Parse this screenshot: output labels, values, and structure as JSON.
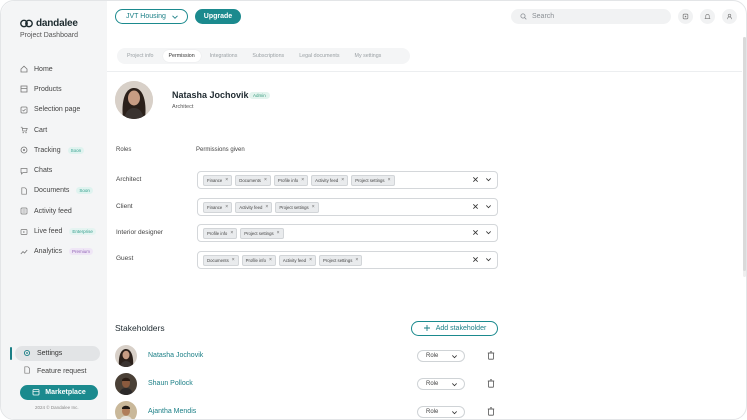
{
  "app": {
    "logo_text": "dandalee",
    "subtitle": "Project Dashboard",
    "copyright": "2024 © Dandalee Inc."
  },
  "sidebar": {
    "items": [
      {
        "label": "Home",
        "icon": "home-icon"
      },
      {
        "label": "Products",
        "icon": "products-icon"
      },
      {
        "label": "Selection page",
        "icon": "selection-icon"
      },
      {
        "label": "Cart",
        "icon": "cart-icon"
      },
      {
        "label": "Tracking",
        "icon": "tracking-icon",
        "tag": "Soon"
      },
      {
        "label": "Chats",
        "icon": "chat-icon"
      },
      {
        "label": "Documents",
        "icon": "documents-icon",
        "tag": "Soon"
      },
      {
        "label": "Activity feed",
        "icon": "activity-icon"
      },
      {
        "label": "Live feed",
        "icon": "live-feed-icon",
        "tag": "Enterprise"
      },
      {
        "label": "Analytics",
        "icon": "analytics-icon",
        "tag": "Premium"
      }
    ],
    "settings_label": "Settings",
    "feature_request_label": "Feature request",
    "marketplace_label": "Marketplace"
  },
  "header": {
    "project_select": "JVT Housing",
    "upgrade_label": "Upgrade",
    "search_placeholder": "Search"
  },
  "tabs": [
    "Project info",
    "Permission",
    "Integrations",
    "Subscriptions",
    "Legal documents",
    "My settings"
  ],
  "active_tab": "Permission",
  "profile": {
    "name": "Natasha Jochovik",
    "badge": "Admin",
    "role": "Architect"
  },
  "roles": {
    "col_roles": "Roles",
    "col_permissions": "Permissions given",
    "rows": [
      {
        "role": "Architect",
        "perms": [
          "Finance",
          "Documents",
          "Profile info",
          "Activity feed",
          "Project settings"
        ]
      },
      {
        "role": "Client",
        "perms": [
          "Finance",
          "Activity feed",
          "Project settings"
        ]
      },
      {
        "role": "Interior designer",
        "perms": [
          "Profile info",
          "Project settings"
        ]
      },
      {
        "role": "Guest",
        "perms": [
          "Documents",
          "Profile info",
          "Activity feed",
          "Project settings"
        ]
      }
    ]
  },
  "stakeholders": {
    "title": "Stakeholders",
    "add_label": "Add stakeholder",
    "rows": [
      {
        "name": "Natasha Jochovik",
        "role": "Role"
      },
      {
        "name": "Shaun Pollock",
        "role": "Role"
      },
      {
        "name": "Ajantha Mendis",
        "role": "Role"
      }
    ]
  },
  "colors": {
    "accent": "#1b8a8e",
    "sidebar_bg": "#f4f5f6",
    "tag_green": "#2f9c8a",
    "tag_premium": "#9062b5"
  }
}
